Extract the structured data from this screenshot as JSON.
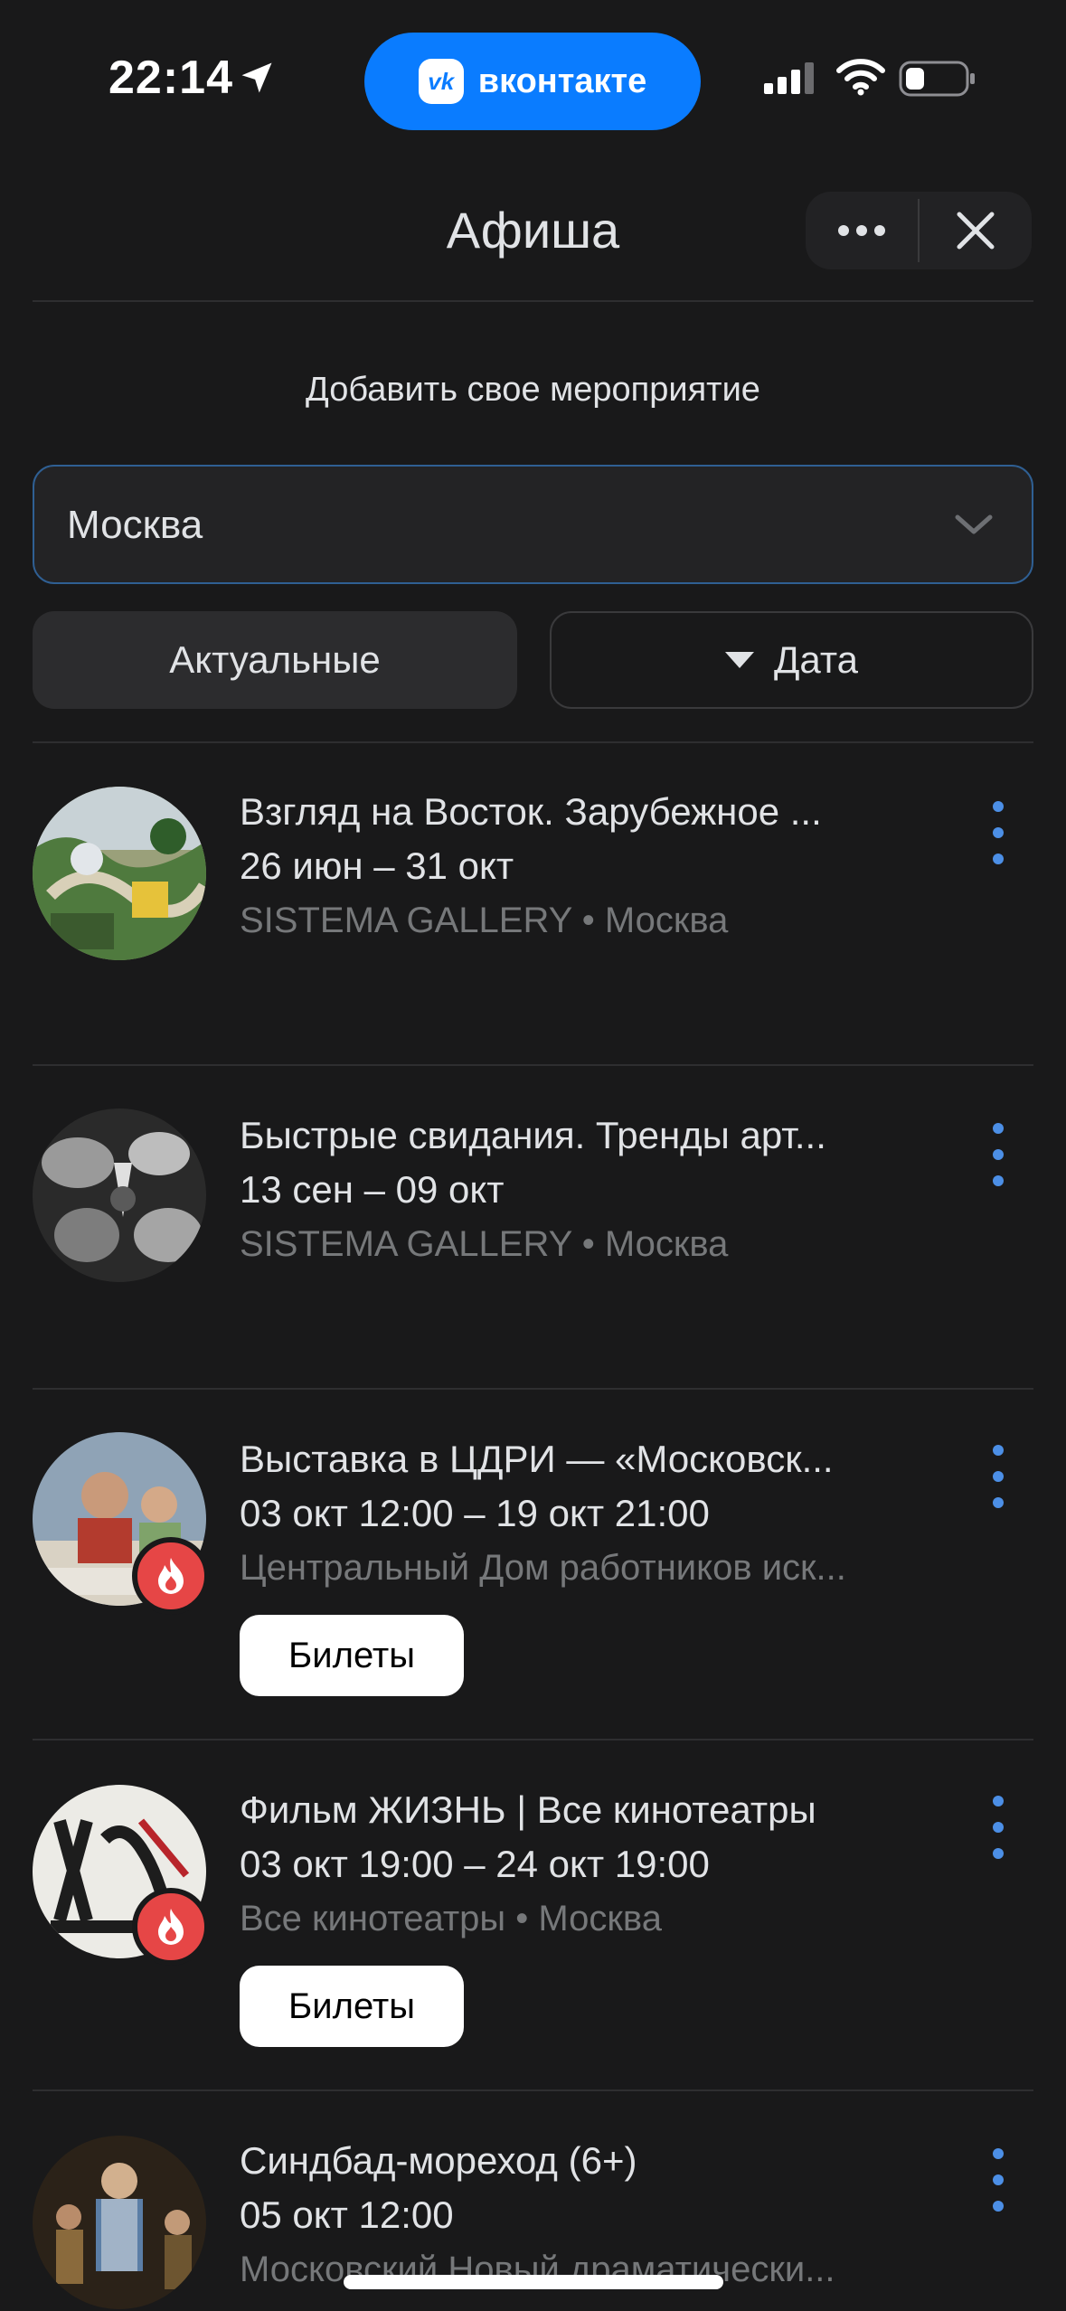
{
  "status_bar": {
    "time": "22:14",
    "app_pill": "вконтакте",
    "app_pill_logo": "vk",
    "icons": [
      "location-arrow-icon",
      "cellular-signal-icon",
      "wifi-icon",
      "battery-icon"
    ]
  },
  "header": {
    "title": "Афиша",
    "more_icon": "more-horizontal-icon",
    "close_icon": "close-icon"
  },
  "add_event_link": "Добавить свое мероприятие",
  "city_select": {
    "value": "Москва",
    "icon": "chevron-down-icon"
  },
  "filters": {
    "actual_label": "Актуальные",
    "date_label": "Дата"
  },
  "events": [
    {
      "title": "Взгляд на Восток. Зарубежное ...",
      "date": "26 июн – 31 окт",
      "place": "SISTEMA GALLERY",
      "city": "Москва",
      "hot": false
    },
    {
      "title": "Быстрые свидания. Тренды арт...",
      "date": "13 сен – 09 окт",
      "place": "SISTEMA GALLERY",
      "city": "Москва",
      "hot": false
    },
    {
      "title": "Выставка в ЦДРИ — «Московск...",
      "date": "03 окт 12:00 – 19 окт 21:00",
      "place": "Центральный Дом работников иск...",
      "hot": true,
      "tickets_label": "Билеты"
    },
    {
      "title": "Фильм ЖИЗНЬ | Все кинотеатры",
      "date": "03 окт 19:00 – 24 окт 19:00",
      "place": "Все кинотеатры",
      "city": "Москва",
      "hot": true,
      "tickets_label": "Билеты"
    },
    {
      "title": "Синдбад-мореход (6+)",
      "date": "05 окт 12:00",
      "place": "Московский Новый драматически...",
      "hot": false
    }
  ],
  "colors": {
    "background": "#19191a",
    "accent": "#0a7cff",
    "more_dots": "#4c8fe6",
    "hot_badge": "#e64646",
    "secondary_text": "#76787a"
  }
}
